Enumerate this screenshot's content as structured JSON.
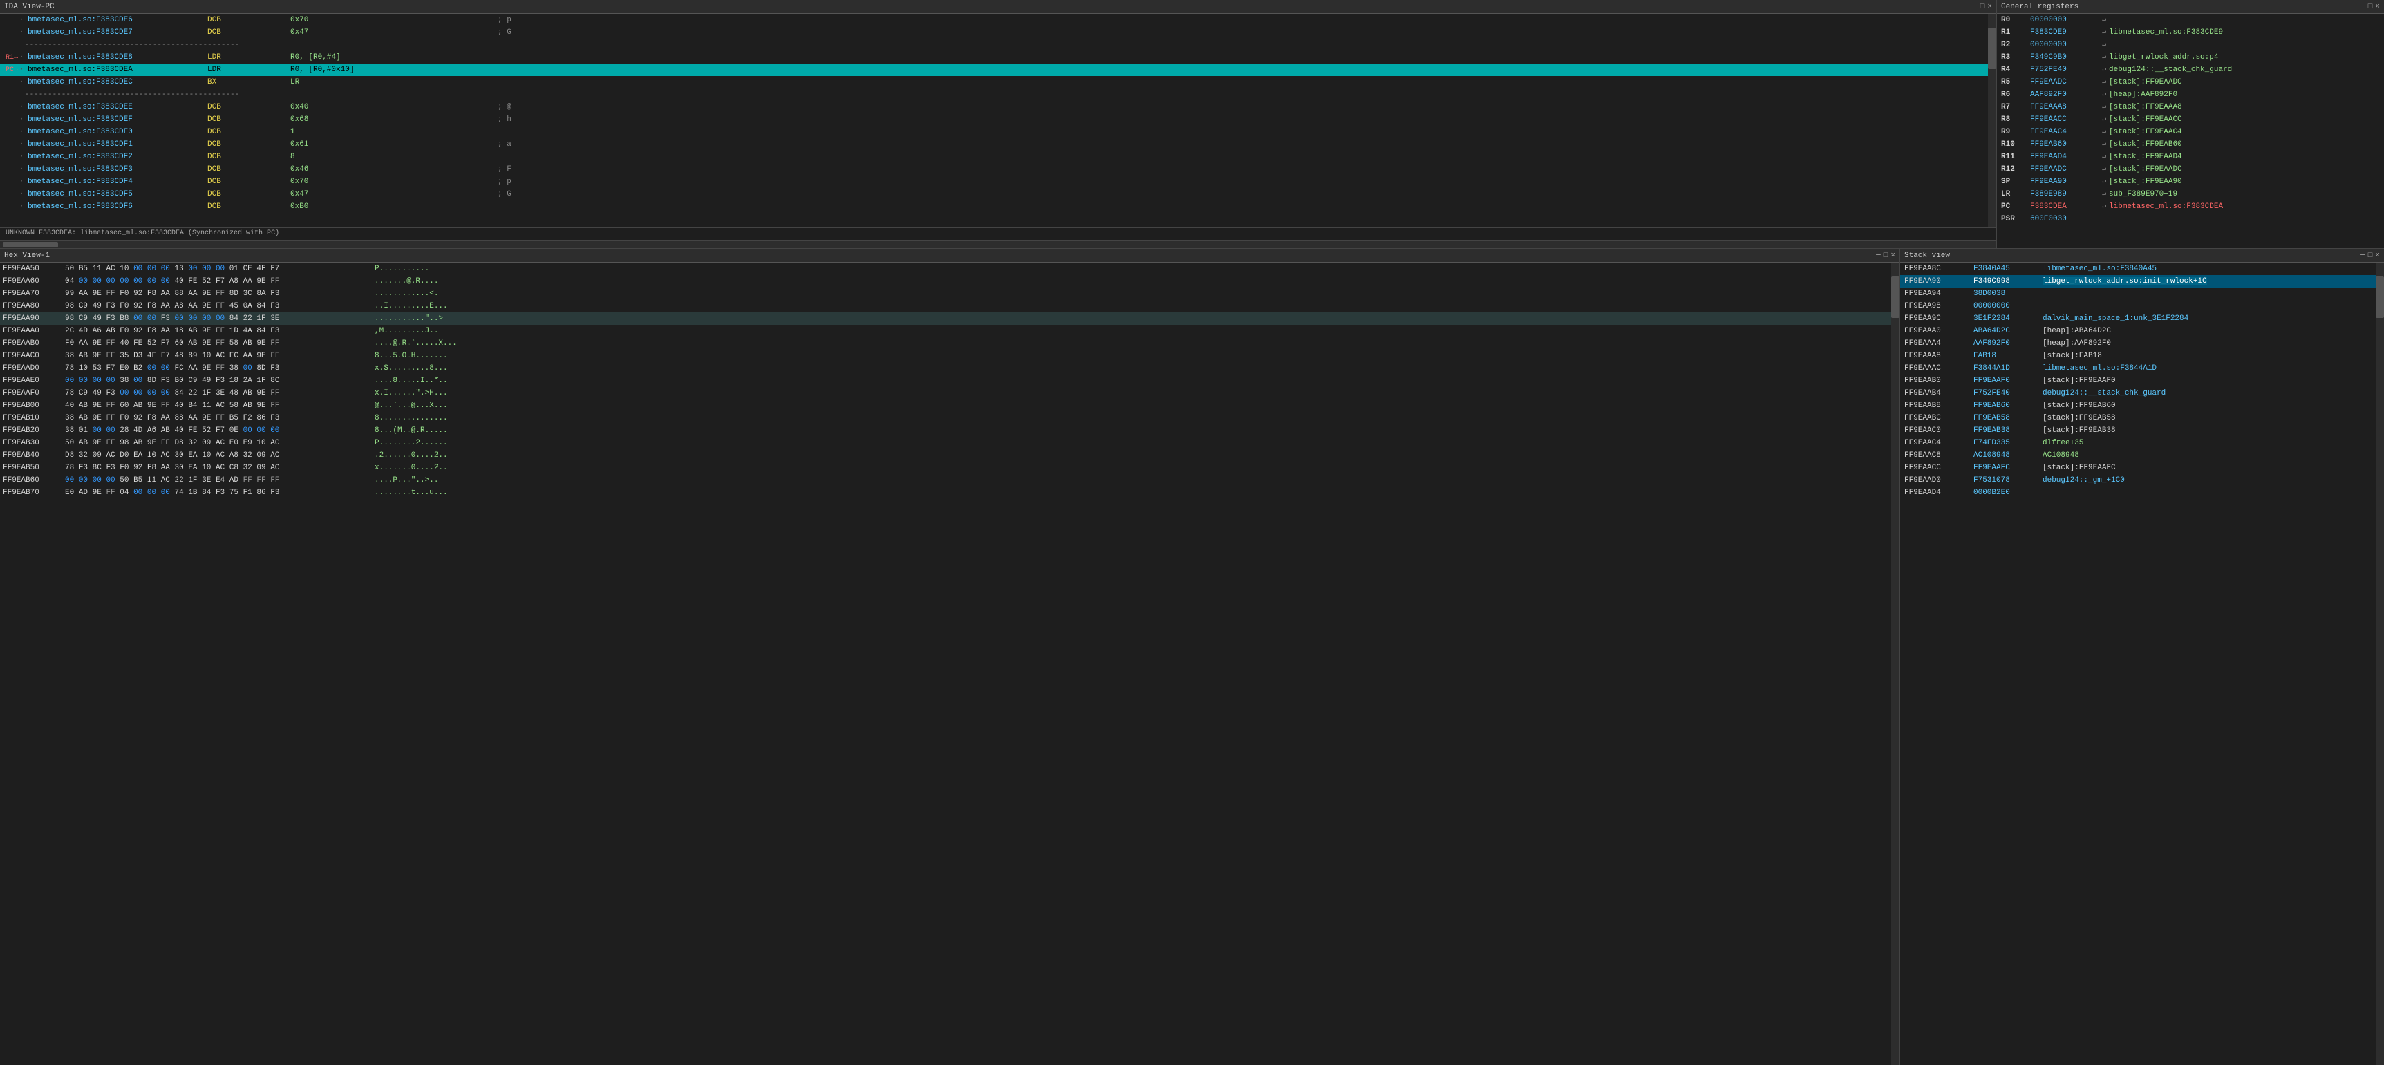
{
  "ida_view": {
    "title": "IDA View-PC",
    "controls": [
      "─",
      "□",
      "×"
    ],
    "lines": [
      {
        "marker": "",
        "dot": "·",
        "addr": "bmetasec_ml.so:F383CDE6",
        "mnemonic": "DCB",
        "operands": "0x70",
        "comment": "; p"
      },
      {
        "marker": "",
        "dot": "·",
        "addr": "bmetasec_ml.so:F383CDE7",
        "mnemonic": "DCB",
        "operands": "0x47",
        "comment": "; G"
      },
      {
        "marker": "",
        "dot": "·",
        "addr": "bmetasec_ml.so:F383CDE8",
        "mnemonic": ";",
        "operands": "",
        "comment": "-----------------------------------------------"
      },
      {
        "marker": "R1→",
        "dot": "·",
        "addr": "bmetasec_ml.so:F383CDE8",
        "mnemonic": "LDR",
        "operands": "R0, [R0,#4]",
        "comment": ""
      },
      {
        "marker": "PC→",
        "dot": "·",
        "addr": "bmetasec_ml.so:F383CDEA",
        "mnemonic": "LDR",
        "operands": "R0, [R0,#0x10]",
        "comment": "",
        "active": true
      },
      {
        "marker": "",
        "dot": "·",
        "addr": "bmetasec_ml.so:F383CDEC",
        "mnemonic": "BX",
        "operands": "LR",
        "comment": ""
      },
      {
        "marker": "",
        "dot": "·",
        "addr": "bmetasec_ml.so:F383CDEC",
        "mnemonic": ";",
        "operands": "",
        "comment": "-----------------------------------------------"
      },
      {
        "marker": "",
        "dot": "·",
        "addr": "bmetasec_ml.so:F383CDEE",
        "mnemonic": "DCB",
        "operands": "0x40",
        "comment": "; @"
      },
      {
        "marker": "",
        "dot": "·",
        "addr": "bmetasec_ml.so:F383CDEF",
        "mnemonic": "DCB",
        "operands": "0x68",
        "comment": "; h"
      },
      {
        "marker": "",
        "dot": "·",
        "addr": "bmetasec_ml.so:F383CDF0",
        "mnemonic": "DCB",
        "operands": "1",
        "comment": ""
      },
      {
        "marker": "",
        "dot": "·",
        "addr": "bmetasec_ml.so:F383CDF1",
        "mnemonic": "DCB",
        "operands": "0x61",
        "comment": "; a"
      },
      {
        "marker": "",
        "dot": "·",
        "addr": "bmetasec_ml.so:F383CDF2",
        "mnemonic": "DCB",
        "operands": "8",
        "comment": ""
      },
      {
        "marker": "",
        "dot": "·",
        "addr": "bmetasec_ml.so:F383CDF3",
        "mnemonic": "DCB",
        "operands": "0x46",
        "comment": "; F"
      },
      {
        "marker": "",
        "dot": "·",
        "addr": "bmetasec_ml.so:F383CDF4",
        "mnemonic": "DCB",
        "operands": "0x70",
        "comment": "; p"
      },
      {
        "marker": "",
        "dot": "·",
        "addr": "bmetasec_ml.so:F383CDF5",
        "mnemonic": "DCB",
        "operands": "0x47",
        "comment": "; G"
      },
      {
        "marker": "",
        "dot": "·",
        "addr": "bmetasec_ml.so:F383CDF6",
        "mnemonic": "DCB",
        "operands": "0xB0",
        "comment": ""
      }
    ],
    "status": "UNKNOWN F383CDEA: libmetasec_ml.so:F383CDEA (Synchronized with PC)"
  },
  "registers": {
    "title": "General registers",
    "controls": [
      "─",
      "□",
      "×"
    ],
    "regs": [
      {
        "name": "R0",
        "value": "00000000",
        "arrow": "↵",
        "ref": ""
      },
      {
        "name": "R1",
        "value": "F383CDE9",
        "arrow": "↵",
        "ref": "libmetasec_ml.so:F383CDE9"
      },
      {
        "name": "R2",
        "value": "00000000",
        "arrow": "↵",
        "ref": ""
      },
      {
        "name": "R3",
        "value": "F349C9B0",
        "arrow": "↵",
        "ref": "libget_rwlock_addr.so:p4"
      },
      {
        "name": "R4",
        "value": "F752FE40",
        "arrow": "↵",
        "ref": "debug124::__stack_chk_guard"
      },
      {
        "name": "R5",
        "value": "FF9EAADC",
        "arrow": "↵",
        "ref": "[stack]:FF9EAADC"
      },
      {
        "name": "R6",
        "value": "AAF892F0",
        "arrow": "↵",
        "ref": "[heap]:AAF892F0"
      },
      {
        "name": "R7",
        "value": "FF9EAAA8",
        "arrow": "↵",
        "ref": "[stack]:FF9EAAA8"
      },
      {
        "name": "R8",
        "value": "FF9EAACC",
        "arrow": "↵",
        "ref": "[stack]:FF9EAACC"
      },
      {
        "name": "R9",
        "value": "FF9EAAC4",
        "arrow": "↵",
        "ref": "[stack]:FF9EAAC4"
      },
      {
        "name": "R10",
        "value": "FF9EAB60",
        "arrow": "↵",
        "ref": "[stack]:FF9EAB60"
      },
      {
        "name": "R11",
        "value": "FF9EAAD4",
        "arrow": "↵",
        "ref": "[stack]:FF9EAAD4"
      },
      {
        "name": "R12",
        "value": "FF9EAADC",
        "arrow": "↵",
        "ref": "[stack]:FF9EAADC"
      },
      {
        "name": "SP",
        "value": "FF9EAA90",
        "arrow": "↵",
        "ref": "[stack]:FF9EAA90"
      },
      {
        "name": "LR",
        "value": "F389E989",
        "arrow": "↵",
        "ref": "sub_F389E970+19"
      },
      {
        "name": "PC",
        "value": "F383CDEA",
        "arrow": "↵",
        "ref": "libmetasec_ml.so:F383CDEA"
      },
      {
        "name": "PSR",
        "value": "600F0030",
        "arrow": "",
        "ref": ""
      }
    ]
  },
  "hex_view": {
    "title": "Hex View-1",
    "controls": [
      "─",
      "□",
      "×"
    ],
    "lines": [
      {
        "addr": "FF9EAA50",
        "bytes": "50 B5 11 AC 10 00 00 00   13 00 00 00 01 CE 4F F7",
        "ascii": "P..........."
      },
      {
        "addr": "FF9EAA60",
        "bytes": "04 00 00 00 00 00 00 00   40 FE 52 F7 A8 AA 9E FF",
        "ascii": ".......@.R...."
      },
      {
        "addr": "FF9EAA70",
        "bytes": "99 AA 9E FF F0 92 F8 AA   88 AA 9E FF 8D 3C 8A F3",
        "ascii": "............<."
      },
      {
        "addr": "FF9EAA80",
        "bytes": "98 C9 49 F3 F0 92 F8 AA   A8 AA 9E FF 45 0A 84 F3",
        "ascii": "..I.........E..."
      },
      {
        "addr": "FF9EAA90",
        "bytes": "98 C9 49 F3 B8 00 00 F3   00 00 00 00 84 22 1F 3E",
        "ascii": "...........\"..>",
        "active": true
      },
      {
        "addr": "FF9EAAA0",
        "bytes": "2C 4D A6 AB F0 92 F8 AA   18 AB 9E FF 1D 4A 84 F3",
        "ascii": ",M.........J.."
      },
      {
        "addr": "FF9EAAB0",
        "bytes": "F0 AA 9E FF 40 FE 52 F7   60 AB 9E FF 58 AB 9E FF",
        "ascii": "....@.R.`.....X..."
      },
      {
        "addr": "FF9EAAC0",
        "bytes": "38 AB 9E FF 35 D3 4F F7   48 89 10 AC FC AA 9E FF",
        "ascii": "8...5.O.H......."
      },
      {
        "addr": "FF9EAAD0",
        "bytes": "78 10 53 F7 E0 B2 00 00   FC AA 9E FF 38 00 8D F3",
        "ascii": "x.S.........8..."
      },
      {
        "addr": "FF9EAAE0",
        "bytes": "00 00 00 00 38 00 8D F3   B0 C9 49 F3 18 2A 1F 8C",
        "ascii": "....8.....I..*.."
      },
      {
        "addr": "FF9EAAF0",
        "bytes": "78 C9 49 F3 00 00 00 00   84 22 1F 3E 48 AB 9E FF",
        "ascii": "x.I......\".>H..."
      },
      {
        "addr": "FF9EAB00",
        "bytes": "40 AB 9E FF 60 AB 9E FF   40 B4 11 AC 58 AB 9E FF",
        "ascii": "@...`...@...X..."
      },
      {
        "addr": "FF9EAB10",
        "bytes": "38 AB 9E FF F0 92 F8 AA   88 AA 9E FF B5 F2 86 F3",
        "ascii": "8..............."
      },
      {
        "addr": "FF9EAB20",
        "bytes": "38 01 00 00 28 4D A6 AB   40 FE 52 F7 0E 00 00 00",
        "ascii": "8...(M..@.R....."
      },
      {
        "addr": "FF9EAB30",
        "bytes": "50 AB 9E FF 98 AB 9E FF   D8 32 09 AC E0 E9 10 AC",
        "ascii": "P........2......"
      },
      {
        "addr": "FF9EAB40",
        "bytes": "D8 32 09 AC D0 EA 10 AC   30 EA 10 AC A8 32 09 AC",
        "ascii": ".2......0....2.."
      },
      {
        "addr": "FF9EAB50",
        "bytes": "78 F3 8C F3 F0 92 F8 AA   30 EA 10 AC C8 32 09 AC",
        "ascii": "x.......0....2.."
      },
      {
        "addr": "FF9EAB60",
        "bytes": "00 00 00 00 50 B5 11 AC   22 1F 3E E4 AD FF FF FF",
        "ascii": "....P...\"..>.."
      },
      {
        "addr": "FF9EAB70",
        "bytes": "E0 AD 9E FF 04 00 00 00   74 1B 84 F3 75 F1 86 F3",
        "ascii": "........t...u..."
      }
    ]
  },
  "stack_view": {
    "title": "Stack view",
    "controls": [
      "─",
      "□",
      "×"
    ],
    "lines": [
      {
        "addr": "FF9EAA8C",
        "value": "F3840A45",
        "ref": "libmetasec_ml.so:F3840A45",
        "bracket": false
      },
      {
        "addr": "FF9EAA90",
        "value": "F349C998",
        "ref": "libget_rwlock_addr.so:init_rwlock+1C",
        "bracket": false,
        "active": true
      },
      {
        "addr": "FF9EAA94",
        "value": "38D0038",
        "ref": "",
        "bracket": false
      },
      {
        "addr": "FF9EAA98",
        "value": "00000000",
        "ref": "",
        "bracket": false
      },
      {
        "addr": "FF9EAA9C",
        "value": "3E1F2284",
        "ref": "dalvik_main_space_1:unk_3E1F2284",
        "bracket": false
      },
      {
        "addr": "FF9EAAA0",
        "value": "ABA64D2C",
        "ref": "[heap]:ABA64D2C",
        "bracket": true
      },
      {
        "addr": "FF9EAAA4",
        "value": "AAF892F0",
        "ref": "[heap]:AAF892F0",
        "bracket": true
      },
      {
        "addr": "FF9EAAA8",
        "value": "FAB18",
        "ref": "[stack]:FAB18",
        "bracket": true
      },
      {
        "addr": "FF9EAAAC",
        "value": "F3844A1D",
        "ref": "libmetasec_ml.so:F3844A1D",
        "bracket": false
      },
      {
        "addr": "FF9EAAB0",
        "value": "FF9EAAF0",
        "ref": "[stack]:FF9EAAF0",
        "bracket": true
      },
      {
        "addr": "FF9EAAB4",
        "value": "F752FE40",
        "ref": "debug124::__stack_chk_guard",
        "bracket": false
      },
      {
        "addr": "FF9EAAB8",
        "value": "FF9EAB60",
        "ref": "[stack]:FF9EAB60",
        "bracket": true
      },
      {
        "addr": "FF9EAABC",
        "value": "FF9EAB58",
        "ref": "[stack]:FF9EAB58",
        "bracket": true
      },
      {
        "addr": "FF9EAAC0",
        "value": "FF9EAB38",
        "ref": "[stack]:FF9EAB38",
        "bracket": true
      },
      {
        "addr": "FF9EAAC4",
        "value": "F74FD335",
        "ref": "dlfree+35",
        "bracket": false
      },
      {
        "addr": "FF9EAAC8",
        "value": "AC108948",
        "ref": "AC108948",
        "bracket": false
      },
      {
        "addr": "FF9EAACC",
        "value": "FF9EAAFC",
        "ref": "[stack]:FF9EAAFC",
        "bracket": true
      },
      {
        "addr": "FF9EAAD0",
        "value": "F7531078",
        "ref": "debug124::_gm_+1C0",
        "bracket": false
      },
      {
        "addr": "FF9EAAD4",
        "value": "0000B2E0",
        "ref": "",
        "bracket": false
      }
    ]
  }
}
